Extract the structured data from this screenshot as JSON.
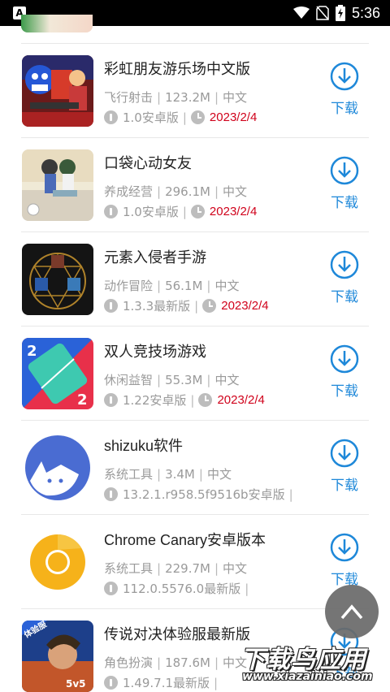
{
  "status_bar": {
    "time": "5:36",
    "left_badge": "A"
  },
  "apps": [
    {
      "name": "彩虹朋友游乐场中文版",
      "category": "飞行射击",
      "size": "123.2M",
      "language": "中文",
      "version": "1.0安卓版",
      "date": "2023/2/4",
      "download_label": "下载",
      "icon": "rainbow-friends-icon"
    },
    {
      "name": "口袋心动女友",
      "category": "养成经营",
      "size": "296.1M",
      "language": "中文",
      "version": "1.0安卓版",
      "date": "2023/2/4",
      "download_label": "下载",
      "icon": "pocket-girlfriend-icon"
    },
    {
      "name": "元素入侵者手游",
      "category": "动作冒险",
      "size": "56.1M",
      "language": "中文",
      "version": "1.3.3最新版",
      "date": "2023/2/4",
      "download_label": "下载",
      "icon": "element-invader-icon"
    },
    {
      "name": "双人竞技场游戏",
      "category": "休闲益智",
      "size": "55.3M",
      "language": "中文",
      "version": "1.22安卓版",
      "date": "2023/2/4",
      "download_label": "下载",
      "icon": "two-player-arena-icon"
    },
    {
      "name": "shizuku软件",
      "category": "系统工具",
      "size": "3.4M",
      "language": "中文",
      "version": "13.2.1.r958.5f9516b安卓版",
      "date": "",
      "download_label": "下载",
      "icon": "shizuku-icon"
    },
    {
      "name": "Chrome Canary安卓版本",
      "category": "系统工具",
      "size": "229.7M",
      "language": "中文",
      "version": "112.0.5576.0最新版",
      "date": "",
      "download_label": "下载",
      "icon": "chrome-canary-icon"
    },
    {
      "name": "传说对决体验服最新版",
      "category": "角色扮演",
      "size": "187.6M",
      "language": "中文",
      "version": "1.49.7.1最新版",
      "date": "",
      "download_label": "下载",
      "icon": "arena-of-valor-icon",
      "badge": "体验服",
      "badge2": "5v5"
    }
  ],
  "watermark": {
    "title": "下载鸟应用",
    "url": "www.xiazainiao.com"
  },
  "colors": {
    "accent": "#1e88d9",
    "date": "#d0021b",
    "meta": "#9a9a9a"
  }
}
